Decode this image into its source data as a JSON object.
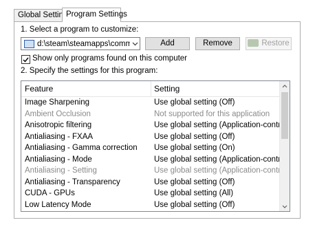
{
  "tabs": [
    {
      "label": "Global Settings"
    },
    {
      "label": "Program Settings"
    }
  ],
  "step1_label": "1. Select a program to customize:",
  "program_combo_value": "d:\\steam\\steamapps\\common\\j...",
  "buttons": {
    "add": "Add",
    "remove": "Remove",
    "restore": "Restore"
  },
  "show_only_found": {
    "label": "Show only programs found on this computer",
    "checked": true
  },
  "step2_label": "2. Specify the settings for this program:",
  "columns": {
    "feature": "Feature",
    "setting": "Setting"
  },
  "rows": [
    {
      "feature": "Image Sharpening",
      "setting": "Use global setting (Off)",
      "disabled": false
    },
    {
      "feature": "Ambient Occlusion",
      "setting": "Not supported for this application",
      "disabled": true
    },
    {
      "feature": "Anisotropic filtering",
      "setting": "Use global setting (Application-controlled)",
      "disabled": false
    },
    {
      "feature": "Antialiasing - FXAA",
      "setting": "Use global setting (Off)",
      "disabled": false
    },
    {
      "feature": "Antialiasing - Gamma correction",
      "setting": "Use global setting (On)",
      "disabled": false
    },
    {
      "feature": "Antialiasing - Mode",
      "setting": "Use global setting (Application-controlled)",
      "disabled": false
    },
    {
      "feature": "Antialiasing - Setting",
      "setting": "Use global setting (Application-controlled)",
      "disabled": true
    },
    {
      "feature": "Antialiasing - Transparency",
      "setting": "Use global setting (Off)",
      "disabled": false
    },
    {
      "feature": "CUDA - GPUs",
      "setting": "Use global setting (All)",
      "disabled": false
    },
    {
      "feature": "Low Latency Mode",
      "setting": "Use global setting (Off)",
      "disabled": false
    }
  ],
  "icons": {
    "combo_program": "program-window-icon",
    "combo_arrow": "chevron-down-icon",
    "restore_logo": "nvidia-logo-icon",
    "checkbox": "checkmark-icon",
    "scroll_up": "scroll-up-arrow-icon",
    "scroll_down": "scroll-down-arrow-icon"
  }
}
